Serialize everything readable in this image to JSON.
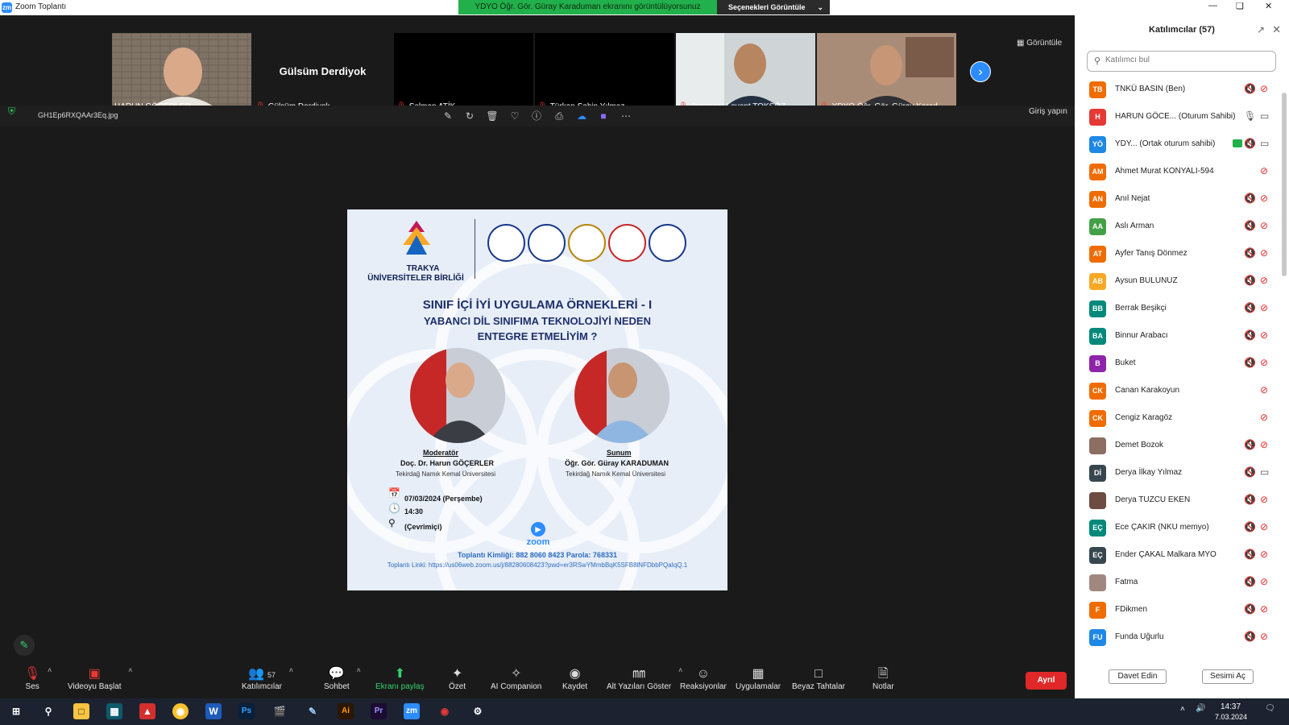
{
  "window": {
    "title": "Zoom Toplantı",
    "app_icon": "zm"
  },
  "share_banner": {
    "text": "YDYO Öğr. Gör. Güray Karaduman ekranını görüntülüyorsunuz",
    "view_options": "Seçenekleri Görüntüle"
  },
  "thumbnails": [
    {
      "name": "HARUN GÖÇERLER",
      "muted": false,
      "active": true
    },
    {
      "name": "Gülsüm Derdiyok",
      "big_name": "Gülsüm Derdiyok",
      "muted": true,
      "active": false
    },
    {
      "name": "Selman ATİK",
      "muted": true,
      "active": false
    },
    {
      "name": "Türkan Şahin Yılmaz",
      "muted": true,
      "active": false
    },
    {
      "name": "Japonca- Levent TOKSÖZ",
      "muted": true,
      "active": false
    },
    {
      "name": "YDYO Öğr. Gör. Güray Karad...",
      "muted": true,
      "active": false
    }
  ],
  "view_button": "Görüntüle",
  "share_toolbar": {
    "filename": "GH1Ep6RXQAAr3Eq.jpg",
    "enter": "Giriş yapın"
  },
  "poster": {
    "org_line1": "TRAKYA",
    "org_line2": "ÜNİVERSİTELER BİRLİĞİ",
    "title1": "SINIF İÇİ İYİ UYGULAMA ÖRNEKLERİ - I",
    "title2": "YABANCI DİL SINIFIMA TEKNOLOJİYİ NEDEN",
    "title3": "ENTEGRE ETMELİYİM ?",
    "moderator_role": "Moderatör",
    "moderator_name": "Doç. Dr. Harun GÖÇERLER",
    "moderator_univ": "Tekirdağ Namık Kemal Üniversitesi",
    "presenter_role": "Sunum",
    "presenter_name": "Öğr. Gör. Güray KARADUMAN",
    "presenter_univ": "Tekirdağ Namık Kemal Üniversitesi",
    "date": "07/03/2024 (Perşembe)",
    "time": "14:30",
    "place": "(Çevrimiçi)",
    "zoom_word": "zoom",
    "meeting_id": "Toplantı Kimliği: 882 8060 8423  Parola: 768331",
    "meeting_link": "Toplantı Linki: https://us06web.zoom.us/j/88280608423?pwd=er3RSwYMmbBqK5SFB8lNFDbbPQaIqQ.1"
  },
  "toolbar": {
    "audio": "Ses",
    "video": "Videoyu Başlat",
    "participants": "Katılımcılar",
    "participants_count": "57",
    "chat": "Sohbet",
    "share": "Ekranı paylaş",
    "summary": "Özet",
    "ai": "AI Companion",
    "record": "Kaydet",
    "captions": "Alt Yazıları Göster",
    "reactions": "Reaksiyonlar",
    "apps": "Uygulamalar",
    "whiteboard": "Beyaz Tahtalar",
    "notes": "Notlar",
    "leave": "Ayrıl"
  },
  "panel": {
    "title": "Katılımcılar (57)",
    "search_placeholder": "Katılımcı bul",
    "invite": "Davet Edin",
    "unmute": "Sesimi Aç",
    "participants": [
      {
        "initials": "TB",
        "name": "TNKÜ BASIN (Ben)",
        "color": "#ef6c00",
        "mic": "muted",
        "cam": "off"
      },
      {
        "initials": "H",
        "name": "HARUN GÖCE...  (Oturum Sahibi)",
        "color": "#e53935",
        "mic": "on",
        "cam": "on"
      },
      {
        "initials": "YÖ",
        "name": "YDY...  (Ortak oturum sahibi)",
        "color": "#1e88e5",
        "mic": "muted",
        "cam": "on",
        "sharing": true
      },
      {
        "initials": "AM",
        "name": "Ahmet Murat KONYALI-594",
        "color": "#ef6c00",
        "mic": "",
        "cam": "off"
      },
      {
        "initials": "AN",
        "name": "Anıl Nejat",
        "color": "#ef6c00",
        "mic": "muted",
        "cam": "off"
      },
      {
        "initials": "AA",
        "name": "Aslı Arman",
        "color": "#43a047",
        "mic": "muted",
        "cam": "off"
      },
      {
        "initials": "AT",
        "name": "Ayfer Tanış Dönmez",
        "color": "#ef6c00",
        "mic": "muted",
        "cam": "off"
      },
      {
        "initials": "AB",
        "name": "Aysun BULUNUZ",
        "color": "#f9a825",
        "mic": "muted",
        "cam": "off"
      },
      {
        "initials": "BB",
        "name": "Berrak Beşikçi",
        "color": "#00897b",
        "mic": "muted",
        "cam": "off"
      },
      {
        "initials": "BA",
        "name": "Binnur Arabacı",
        "color": "#00897b",
        "mic": "muted",
        "cam": "off"
      },
      {
        "initials": "B",
        "name": "Buket",
        "color": "#8e24aa",
        "mic": "muted",
        "cam": "off"
      },
      {
        "initials": "CK",
        "name": "Canan Karakoyun",
        "color": "#ef6c00",
        "mic": "",
        "cam": "off"
      },
      {
        "initials": "CK",
        "name": "Cengiz Karagöz",
        "color": "#ef6c00",
        "mic": "",
        "cam": "off"
      },
      {
        "initials": "",
        "name": "Demet Bozok",
        "color": "#8d6e63",
        "mic": "muted",
        "cam": "off"
      },
      {
        "initials": "Dİ",
        "name": "Derya İlkay Yılmaz",
        "color": "#37474f",
        "mic": "muted",
        "cam": "on"
      },
      {
        "initials": "",
        "name": "Derya TUZCU EKEN",
        "color": "#6d4c41",
        "mic": "muted",
        "cam": "off"
      },
      {
        "initials": "EÇ",
        "name": "Ece ÇAKIR (NKU memyo)",
        "color": "#00897b",
        "mic": "muted",
        "cam": "off"
      },
      {
        "initials": "EÇ",
        "name": "Ender ÇAKAL Malkara MYO",
        "color": "#37474f",
        "mic": "muted",
        "cam": "off"
      },
      {
        "initials": "",
        "name": "Fatma",
        "color": "#a1887f",
        "mic": "muted",
        "cam": "off"
      },
      {
        "initials": "F",
        "name": "FDikmen",
        "color": "#ef6c00",
        "mic": "muted",
        "cam": "off"
      },
      {
        "initials": "FU",
        "name": "Funda Uğurlu",
        "color": "#1e88e5",
        "mic": "muted",
        "cam": "off"
      }
    ]
  },
  "taskbar": {
    "time": "14:37",
    "date": "7.03.2024"
  }
}
